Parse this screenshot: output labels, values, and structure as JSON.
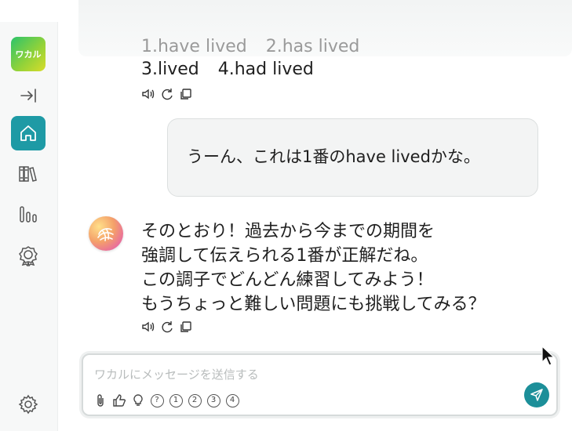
{
  "app": {
    "logo_text": "ワカル"
  },
  "sidebar": {
    "items": [
      {
        "name": "collapse",
        "icon": "collapse-arrow-icon"
      },
      {
        "name": "home",
        "icon": "home-icon",
        "active": true
      },
      {
        "name": "library",
        "icon": "books-icon"
      },
      {
        "name": "stats",
        "icon": "bar-chart-icon"
      },
      {
        "name": "achievements",
        "icon": "badge-icon"
      }
    ],
    "settings_icon": "gear-icon"
  },
  "chat": {
    "question_options_line1": [
      "1.have lived",
      "2.has lived"
    ],
    "question_options_line2": [
      "3.lived",
      "4.had lived"
    ],
    "user_message": "うーん、これは1番のhave livedかな。",
    "assistant_reply": [
      "そのとおり！過去から今までの期間を",
      "強調して伝えられる1番が正解だね。",
      "この調子でどんどん練習してみよう！",
      "もうちょっと難しい問題にも挑戦してみる？"
    ]
  },
  "input": {
    "placeholder": "ワカルにメッセージを送信する",
    "value": "",
    "tools": [
      "attach-icon",
      "thumbs-up-icon",
      "lightbulb-icon",
      "?",
      "1",
      "2",
      "3",
      "4"
    ]
  },
  "colors": {
    "accent": "#1e9aa5",
    "send": "#1c8f99"
  }
}
